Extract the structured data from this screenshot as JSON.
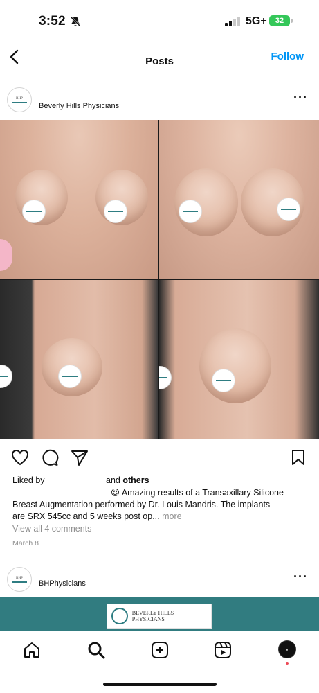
{
  "status_bar": {
    "time": "3:52",
    "network": "5G+",
    "battery": "32",
    "icons": [
      "bell-off-icon",
      "signal-icon",
      "battery-icon"
    ]
  },
  "nav": {
    "title": "Posts",
    "follow_label": "Follow",
    "back_icon": "chevron-left-icon"
  },
  "post": {
    "author": "Beverly Hills Physicians",
    "avatar_icon": "clinic-logo",
    "more_icon": "ellipsis-icon",
    "image_description_icon": "before-after-photo-grid",
    "actions": {
      "icons": [
        "heart-icon",
        "comment-icon",
        "send-icon",
        "bookmark-icon"
      ]
    },
    "liked_by_prefix": "Liked by",
    "liked_by_and": "and",
    "liked_by_others": "others",
    "caption_line1": "😍 Amazing results of a Transaxillary Silicone",
    "caption_line2": "Breast Augmentation performed by Dr. Louis Mandris. The implants",
    "caption_line3": "are SRX 545cc and 5 weeks post op...",
    "more_label": "more",
    "view_comments": "View all 4 comments",
    "date": "March 8"
  },
  "post2": {
    "author": "BHPhysicians",
    "more_icon": "ellipsis-icon"
  },
  "tab_bar": {
    "icons": [
      "home-icon",
      "search-icon",
      "create-icon",
      "reels-icon",
      "profile-avatar"
    ]
  },
  "colors": {
    "accent": "#0095f6",
    "brand_teal": "#317c80",
    "battery": "#34c759",
    "notification": "#ed4956"
  }
}
